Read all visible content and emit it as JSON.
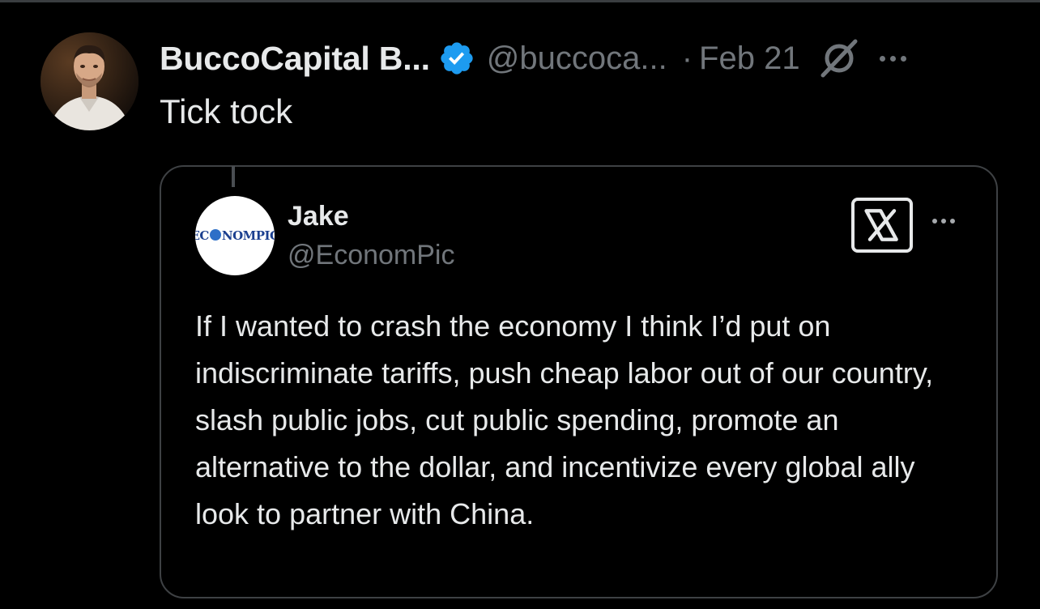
{
  "tweet": {
    "display_name": "BuccoCapital B...",
    "handle": "@buccoca...",
    "separator": "·",
    "date": "Feb 21",
    "text": "Tick tock"
  },
  "quote": {
    "name": "Jake",
    "handle": "@EconomPic",
    "avatar_logo": {
      "before": "EC",
      "after": "NOMPIC"
    },
    "text": "If I wanted to crash the economy I think I’d put on indiscriminate tariffs, push cheap labor out of our country, slash public jobs, cut public spending, promote an alternative to the dollar, and incentivize every global ally look to partner with China."
  },
  "icons": {
    "verified": "verified-badge-icon",
    "grok": "grok-icon",
    "more": "more-icon",
    "x_logo": "x-logo-icon"
  },
  "colors": {
    "background": "#000000",
    "text_primary": "#e7e9ea",
    "text_secondary": "#71767b",
    "verified_blue": "#1d9bf0",
    "border": "#3e4144"
  }
}
